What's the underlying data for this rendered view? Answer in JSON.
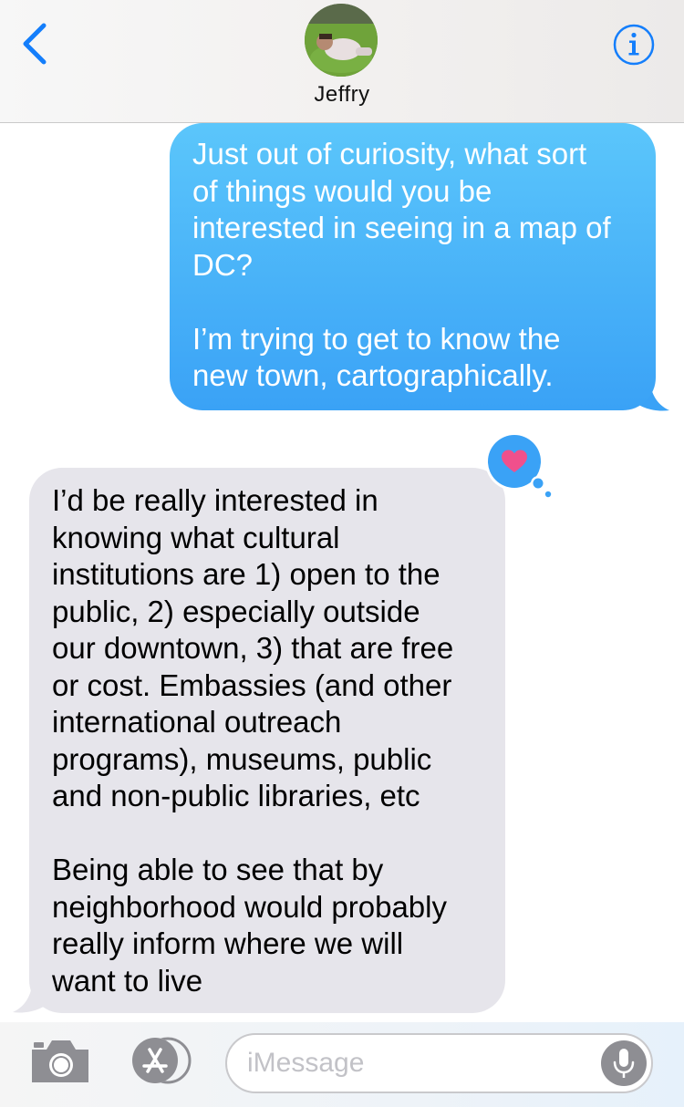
{
  "header": {
    "back_icon": "chevron-left-icon",
    "contact_name": "Jeffry",
    "avatar_icon": "contact-avatar-photo",
    "info_icon": "info-icon"
  },
  "messages": [
    {
      "direction": "outgoing",
      "text": "Just out of curiosity, what sort\nof things would you be\ninterested in seeing in a map of\nDC?\n\nI’m trying to get to know the\nnew town, cartographically."
    },
    {
      "direction": "incoming",
      "text": "I’d be really interested in\nknowing what cultural\ninstitutions are 1) open to the\npublic, 2) especially outside\nour downtown, 3) that are free\nor cost. Embassies (and other\ninternational outreach\nprograms), museums, public\nand non-public libraries, etc\n\nBeing able to see that by\nneighborhood would probably\nreally inform where we will\nwant to live"
    }
  ],
  "tapback": {
    "icon": "heart-icon",
    "color": "#f0508c"
  },
  "input_bar": {
    "camera_icon": "camera-icon",
    "apps_icon": "app-store-icon",
    "placeholder": "iMessage",
    "mic_icon": "microphone-icon"
  },
  "colors": {
    "accent": "#147efb",
    "outgoing_top": "#5bc6fb",
    "outgoing_bottom": "#3aa2f6",
    "incoming_bubble": "#e6e5eb"
  }
}
